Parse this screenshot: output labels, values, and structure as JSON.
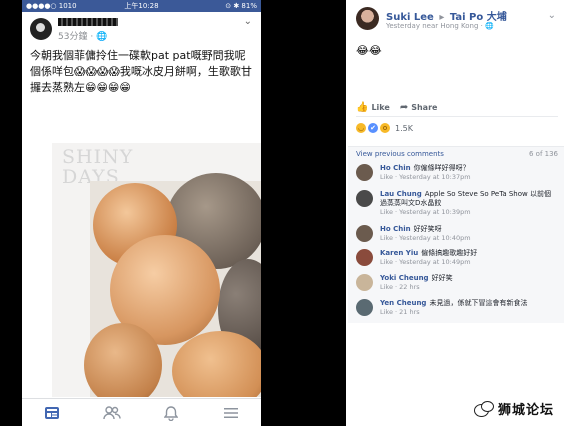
{
  "status_bar": {
    "carrier": "●●●●○ 1010 ",
    "time": "上午10:28",
    "battery": "⊙ ✱ 81%"
  },
  "post": {
    "time": "53分鐘 · ",
    "text": "今朝我個菲傭拎住一碟軟pat pat嘅野問我呢個係咩包😱😱😱😱我嘅冰皮月餅啊，生歌歌甘攞去蒸熟左😁😁😁😁",
    "watermark_line1": "SHINY",
    "watermark_line2": "DAYS"
  },
  "tabbar": {
    "icons": [
      "news-feed-icon",
      "friends-icon",
      "notifications-icon",
      "menu-icon"
    ]
  },
  "shared_post": {
    "author": "Suki Lee",
    "arrow": "▸",
    "target": "Tai Po 大埔",
    "meta": "Yesterday near Hong Kong · 🌐",
    "body": "😂😂",
    "like_label": "Like",
    "share_label": "Share",
    "reaction_count": "1.5K",
    "view_previous": "View previous comments",
    "comment_count": "6 of 136"
  },
  "comments": [
    {
      "name": "Ho Chin",
      "text": "你僱條咩好得呀？",
      "wrap": "",
      "meta": "Like · Yesterday at 10:37pm",
      "color": "#6b5b4e"
    },
    {
      "name": "Lau Chung",
      "text": "Apple So Steve So PeTa Show 以前個",
      "wrap": "過蒸蒸叫文D水晶餃",
      "meta": "Like · Yesterday at 10:39pm",
      "color": "#4a4a4a"
    },
    {
      "name": "Ho Chin",
      "text": "好好笑呀",
      "wrap": "",
      "meta": "Like · Yesterday at 10:40pm",
      "color": "#6b5b4e"
    },
    {
      "name": "Karen Yiu",
      "text": "僱條搞趣歌趣好好",
      "wrap": "",
      "meta": "Like · Yesterday at 10:49pm",
      "color": "#8a4b3c"
    },
    {
      "name": "Yoki Cheung",
      "text": "好好笑",
      "wrap": "",
      "meta": "Like · 22 hrs",
      "color": "#c9b59a"
    },
    {
      "name": "Yen Cheung",
      "text": "未見過，係就下冒這會有新食法",
      "wrap": "",
      "meta": "Like · 21 hrs",
      "color": "#5a6a72"
    }
  ],
  "logo": {
    "text": "狮城论坛"
  }
}
